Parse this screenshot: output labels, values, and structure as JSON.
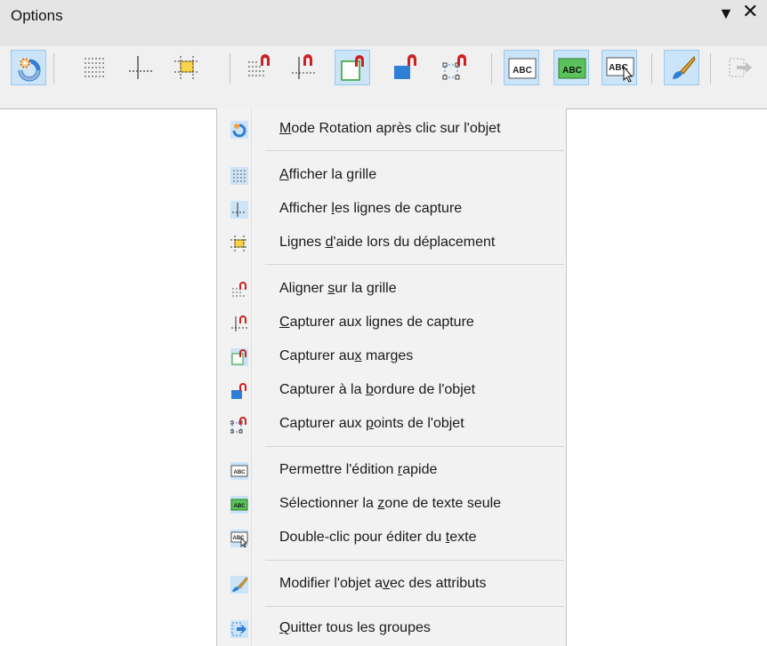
{
  "panel": {
    "title": "Options",
    "dropdown_icon": "triangle-down-icon",
    "close_icon": "close-icon"
  },
  "toolbar": {
    "buttons": [
      {
        "name": "rotation-mode",
        "icon": "rotate-icon",
        "active": true
      },
      {
        "name": "show-grid",
        "icon": "grid-icon",
        "active": false
      },
      {
        "name": "show-snap-lines",
        "icon": "snap-lines-icon",
        "active": false
      },
      {
        "name": "helplines-while-moving",
        "icon": "helplines-icon",
        "active": false
      },
      {
        "name": "snap-to-grid",
        "icon": "snap-grid-icon",
        "active": false
      },
      {
        "name": "snap-to-snap-lines",
        "icon": "snap-lines-magnet-icon",
        "active": false
      },
      {
        "name": "snap-to-page-margins",
        "icon": "snap-margins-icon",
        "active": true
      },
      {
        "name": "snap-to-object-border",
        "icon": "snap-border-icon",
        "active": false
      },
      {
        "name": "snap-to-object-points",
        "icon": "snap-points-icon",
        "active": false
      },
      {
        "name": "allow-quick-editing",
        "icon": "abc-icon",
        "active": true,
        "text": "ABC"
      },
      {
        "name": "select-text-area-only",
        "icon": "abc-green-icon",
        "active": true,
        "text": "ABC"
      },
      {
        "name": "double-click-edit-text",
        "icon": "abc-cursor-icon",
        "active": true,
        "text": "ABC"
      },
      {
        "name": "modify-object-with-attributes",
        "icon": "brush-icon",
        "active": true
      },
      {
        "name": "exit-all-groups",
        "icon": "exit-group-icon",
        "active": false
      }
    ]
  },
  "menu": {
    "items": [
      {
        "pre": "",
        "acc": "M",
        "post": "ode Rotation après clic sur l'objet",
        "icon": "rotate-icon"
      },
      {
        "pre": "",
        "acc": "A",
        "post": "fficher la grille",
        "icon": "grid-icon"
      },
      {
        "pre": "Afficher ",
        "acc": "l",
        "post": "es lignes de capture",
        "icon": "snap-lines-icon"
      },
      {
        "pre": "Lignes ",
        "acc": "d",
        "post": "'aide lors du déplacement",
        "icon": "helplines-icon"
      },
      {
        "pre": "Aligner ",
        "acc": "s",
        "post": "ur la grille",
        "icon": "snap-grid-icon"
      },
      {
        "pre": "",
        "acc": "C",
        "post": "apturer aux lignes de capture",
        "icon": "snap-lines-magnet-icon"
      },
      {
        "pre": "Capturer au",
        "acc": "x",
        "post": " marges",
        "icon": "snap-margins-icon"
      },
      {
        "pre": "Capturer à la ",
        "acc": "b",
        "post": "ordure de l'objet",
        "icon": "snap-border-icon"
      },
      {
        "pre": "Capturer aux ",
        "acc": "p",
        "post": "oints de l'objet",
        "icon": "snap-points-icon"
      },
      {
        "pre": "Permettre l'édition ",
        "acc": "r",
        "post": "apide",
        "icon": "abc-icon"
      },
      {
        "pre": "Sélectionner la ",
        "acc": "z",
        "post": "one de texte seule",
        "icon": "abc-green-icon"
      },
      {
        "pre": "Double-clic pour éditer du ",
        "acc": "t",
        "post": "exte",
        "icon": "abc-cursor-icon"
      },
      {
        "pre": "Modifier l'objet a",
        "acc": "v",
        "post": "ec des attributs",
        "icon": "brush-icon"
      },
      {
        "pre": "",
        "acc": "Q",
        "post": "uitter tous les groupes",
        "icon": "exit-group-icon"
      }
    ]
  },
  "colors": {
    "accent": "#cce4f7",
    "accent_border": "#99c9ef",
    "magnet": "#cc2222",
    "abc_green": "#2e9e2e",
    "shape_blue": "#2f7fd6"
  }
}
